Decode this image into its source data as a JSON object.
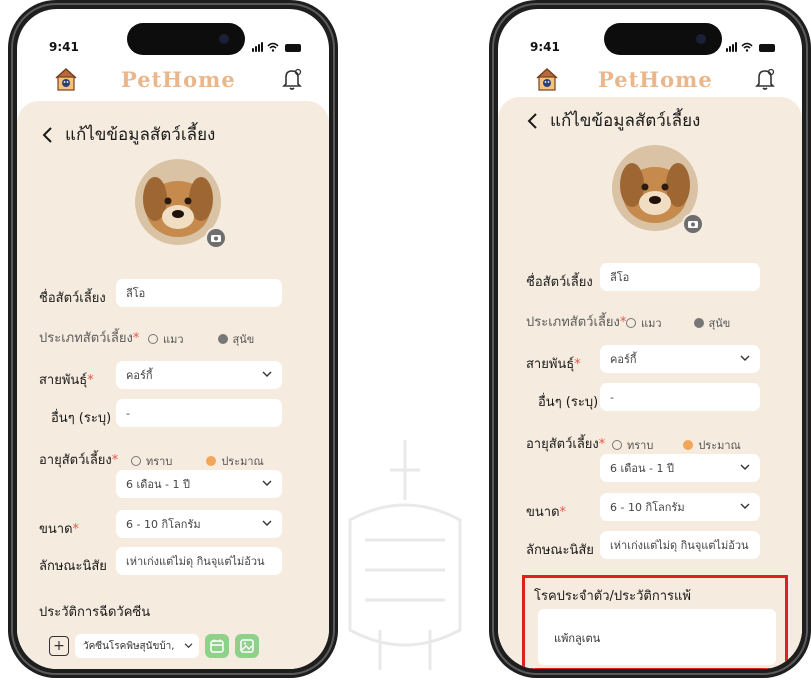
{
  "status": {
    "time": "9:41"
  },
  "app": {
    "name": "PetHome"
  },
  "header": {
    "title": "แก้ไขข้อมูลสัตว์เลี้ยง"
  },
  "form": {
    "pet_name_label": "ชื่อสัตว์เลี้ยง",
    "pet_name_value": "ลีโอ",
    "pet_type_label": "ประเภทสัตว์เลี้ยง",
    "pet_type_options": [
      "แมว",
      "สุนัข"
    ],
    "pet_type_selected": "สุนัข",
    "breed_label": "สายพันธุ์",
    "breed_value": "คอร์กี้",
    "other_label": "อื่นๆ (ระบุ)",
    "other_value": "-",
    "age_label": "อายุสัตว์เลี้ยง",
    "age_options": [
      "ทราบ",
      "ประมาณ"
    ],
    "age_selected": "ประมาณ",
    "age_value": "6 เดือน - 1 ปี",
    "size_label": "ขนาด",
    "size_value": "6 - 10 กิโลกรัม",
    "trait_label": "ลักษณะนิสัย",
    "trait_value": "เห่าเก่งแต่ไม่ดุ กินจุแต่ไม่อ้วน",
    "required_mark": "*"
  },
  "vaccine": {
    "section_title": "ประวัติการฉีดวัคซีน",
    "selected": "วัคซีนโรคพิษสุนัขบ้า,"
  },
  "allergy": {
    "section_title": "โรคประจำตัว/ประวัติการแพ้",
    "value": "แพ้กลูเตน"
  },
  "colors": {
    "background": "#f6ebdf",
    "accent": "#e9b78b",
    "required": "#e05a4f",
    "radio_selected_orange": "#f1a659",
    "action_green": "#8fd08a",
    "highlight": "#e02020"
  },
  "icons": {
    "back": "chevron-left-icon",
    "home": "house-icon",
    "notification": "bell-icon",
    "camera": "camera-icon",
    "dropdown": "chevron-down-icon",
    "add": "plus-icon",
    "calendar": "calendar-icon",
    "image": "image-upload-icon"
  }
}
